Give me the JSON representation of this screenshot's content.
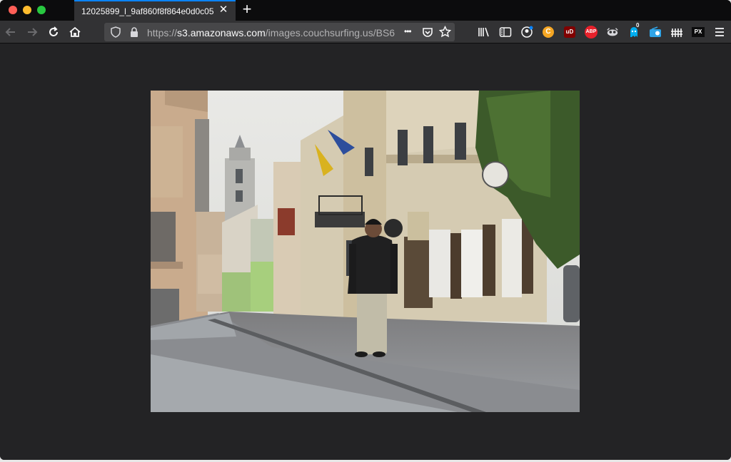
{
  "tab": {
    "title": "12025899_l_9af860f8f864e0d0c05",
    "close_glyph": "✕",
    "new_tab_glyph": "+"
  },
  "toolbar": {
    "url_scheme": "https://",
    "url_host": "s3.amazonaws.com",
    "url_path": "/images.couchsurfing.us/BS6",
    "more_glyph": "•••"
  },
  "extensions": {
    "abp_label": "ABP",
    "ud_label": "uD",
    "c_label": "C",
    "badge_count": "0",
    "px_label": "PX"
  },
  "image": {
    "alt": "Man standing on a cobblestone street between old buildings"
  },
  "colors": {
    "tab_accent": "#0a84ff",
    "page_bg": "#232325",
    "toolbar_bg": "#323234",
    "urlbar_bg": "#474749"
  }
}
